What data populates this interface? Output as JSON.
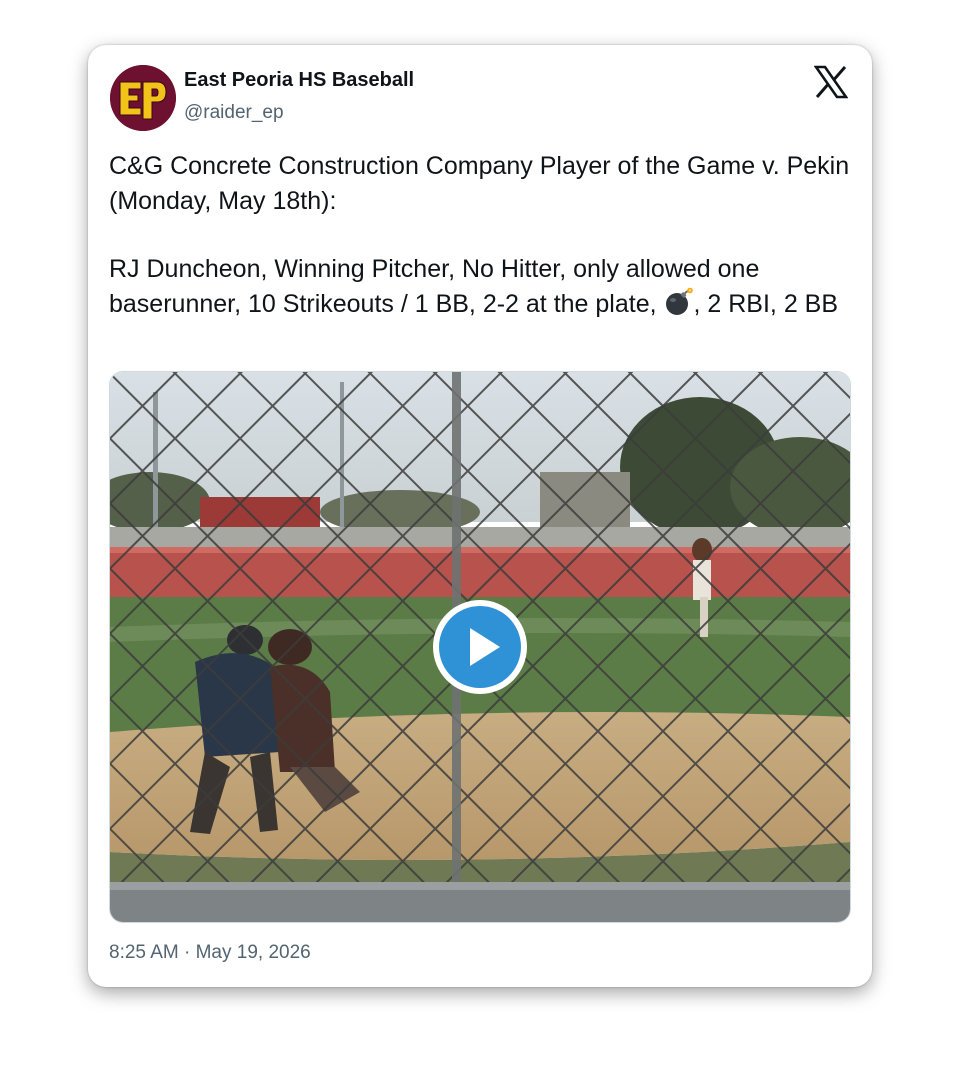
{
  "author": {
    "name": "East Peoria HS Baseball",
    "handle": "@raider_ep",
    "avatar_initials": "EP",
    "avatar_colors": {
      "background": "#6e1030",
      "letters": "#f2c318"
    }
  },
  "platform_icon": "x-logo-icon",
  "tweet": {
    "paragraph_1": "C&G Concrete Construction Company Player of the Game v. Pekin (Monday, May 18th):",
    "paragraph_2_before_emoji": "RJ Duncheon, Winning Pitcher, No Hitter, only allowed one baserunner, 10 Strikeouts / 1 BB, 2-2 at the plate, ",
    "emoji_icon": "bomb-icon",
    "paragraph_2_after_emoji": ", 2 RBI, 2 BB"
  },
  "media": {
    "type": "video",
    "play_icon": "play-icon",
    "accent_color": "#2f92d6"
  },
  "timestamp": {
    "time": "8:25 AM",
    "separator": " · ",
    "date": "May 19, 2026"
  },
  "colors": {
    "text_primary": "#0f1419",
    "text_secondary": "#536471"
  }
}
